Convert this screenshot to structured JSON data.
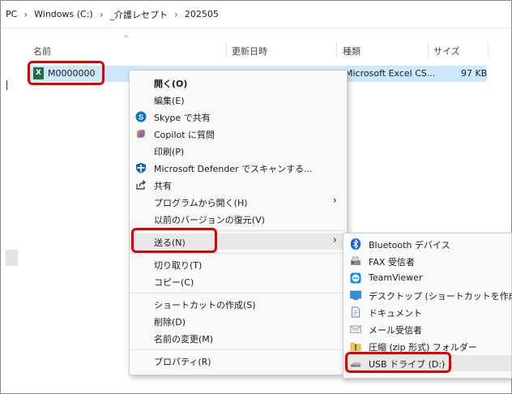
{
  "breadcrumb": {
    "root": "PC",
    "items": [
      "Windows (C:)",
      "_介護レセプト",
      "202505"
    ]
  },
  "columns": {
    "name": "名前",
    "date": "更新日時",
    "type": "種類",
    "size": "サイズ"
  },
  "file": {
    "name": "M0000000",
    "type": "Microsoft Excel CS...",
    "size": "97 KB"
  },
  "context_menu": {
    "open": "開く(O)",
    "edit": "編集(E)",
    "skype": "Skype で共有",
    "copilot": "Copilot に質問",
    "print": "印刷(P)",
    "defender": "Microsoft Defender でスキャンする...",
    "share": "共有",
    "open_with": "プログラムから開く(H)",
    "restore": "以前のバージョンの復元(V)",
    "send_to": "送る(N)",
    "cut": "切り取り(T)",
    "copy": "コピー(C)",
    "create_shortcut": "ショートカットの作成(S)",
    "delete": "削除(D)",
    "rename": "名前の変更(M)",
    "properties": "プロパティ(R)"
  },
  "send_to_menu": {
    "bluetooth": "Bluetooth デバイス",
    "fax": "FAX 受信者",
    "teamviewer": "TeamViewer",
    "desktop": "デスクトップ (ショートカットを作成)",
    "documents": "ドキュメント",
    "mail": "メール受信者",
    "zip": "圧縮 (zip 形式) フォルダー",
    "usb": "USB ドライブ (D:)"
  },
  "colors": {
    "selection": "#cce8ff",
    "highlight_box": "#e00000",
    "menu_bg": "#f9f9f9"
  }
}
